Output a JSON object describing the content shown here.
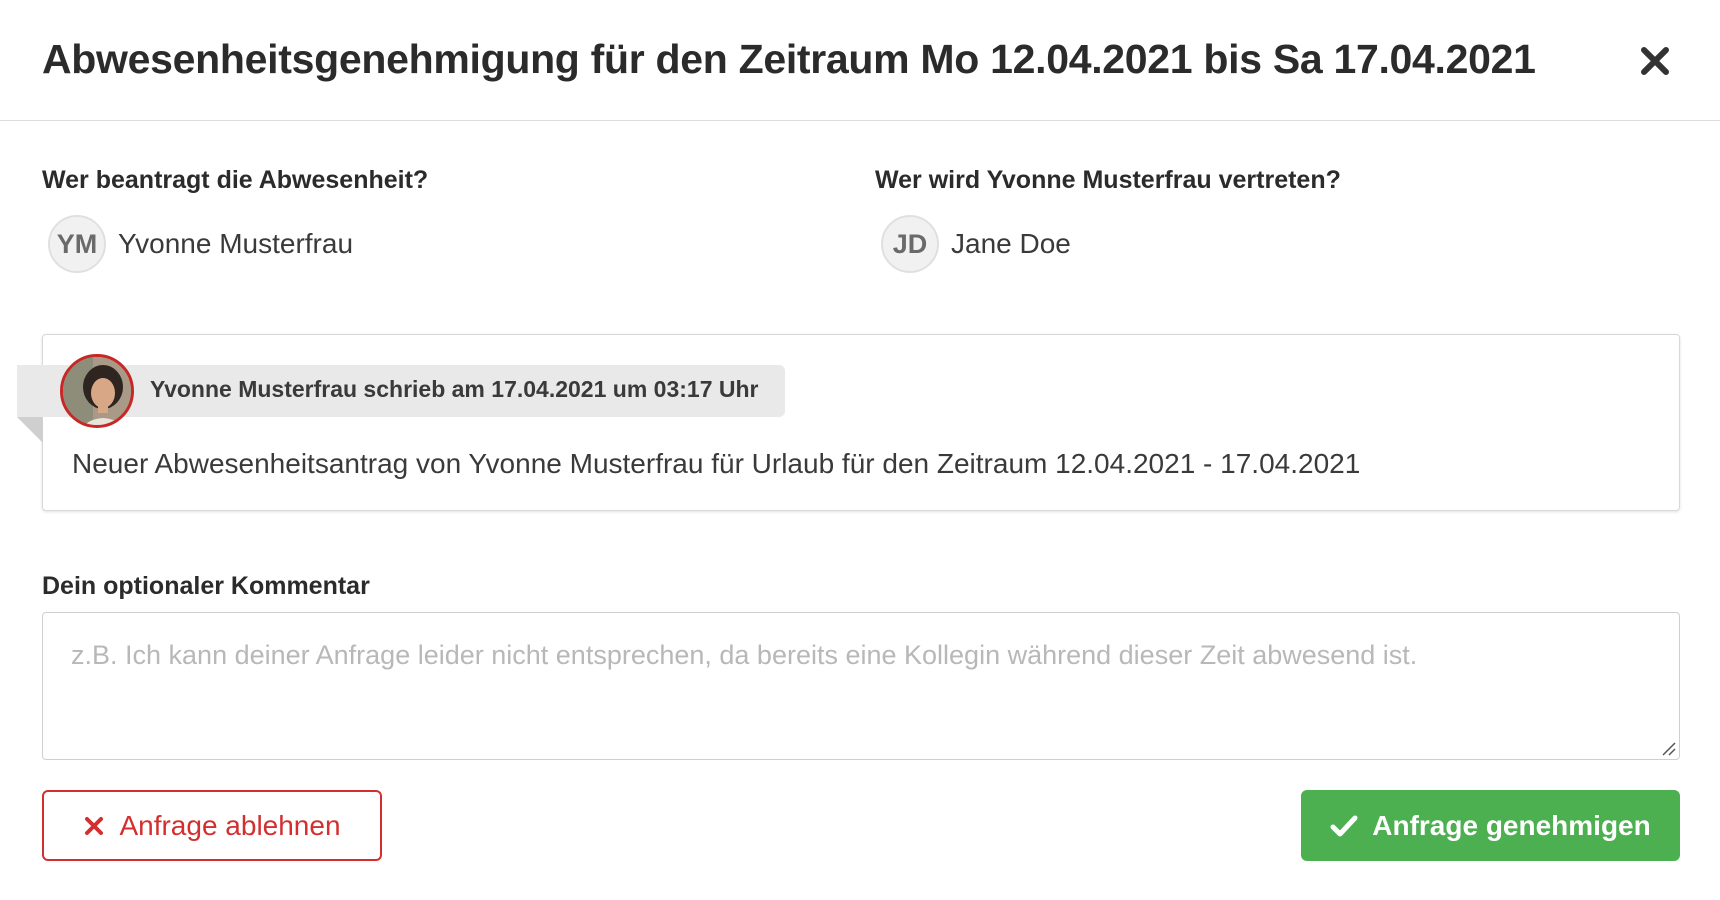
{
  "dialog": {
    "title": "Abwesenheitsgenehmigung für den Zeitraum Mo 12.04.2021 bis Sa 17.04.2021",
    "close_icon": "close-icon"
  },
  "requester": {
    "label": "Wer beantragt die Abwesenheit?",
    "initials": "YM",
    "name": "Yvonne Musterfrau"
  },
  "substitute": {
    "label": "Wer wird Yvonne Musterfrau vertreten?",
    "initials": "JD",
    "name": "Jane Doe"
  },
  "comment": {
    "author_line": "Yvonne Musterfrau schrieb am 17.04.2021 um 03:17 Uhr",
    "body": "Neuer Abwesenheitsantrag von Yvonne Musterfrau für Urlaub für den Zeitraum 12.04.2021 - 17.04.2021"
  },
  "your_comment": {
    "label": "Dein optionaler Kommentar",
    "placeholder": "z.B. Ich kann deiner Anfrage leider nicht entsprechen, da bereits eine Kollegin während dieser Zeit abwesend ist.",
    "value": ""
  },
  "actions": {
    "reject_label": "Anfrage ablehnen",
    "approve_label": "Anfrage genehmigen"
  },
  "colors": {
    "reject": "#d32f2f",
    "approve": "#4caf50",
    "avatar_ring": "#c62828"
  }
}
